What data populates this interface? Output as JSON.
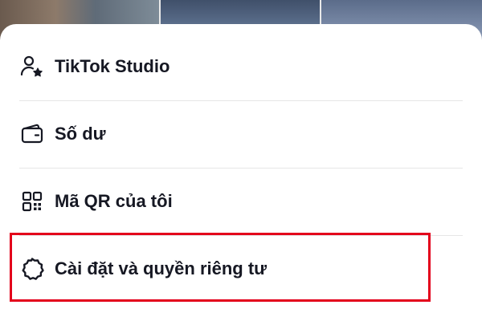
{
  "menu": {
    "items": [
      {
        "label": "TikTok Studio",
        "icon": "person-star-icon"
      },
      {
        "label": "Số dư",
        "icon": "wallet-icon"
      },
      {
        "label": "Mã QR của tôi",
        "icon": "qr-code-icon"
      },
      {
        "label": "Cài đặt và quyền riêng tư",
        "icon": "gear-icon"
      }
    ]
  },
  "annotation": {
    "highlight_color": "#e3001b",
    "highlighted_item": "Cài đặt và quyền riêng tư"
  }
}
